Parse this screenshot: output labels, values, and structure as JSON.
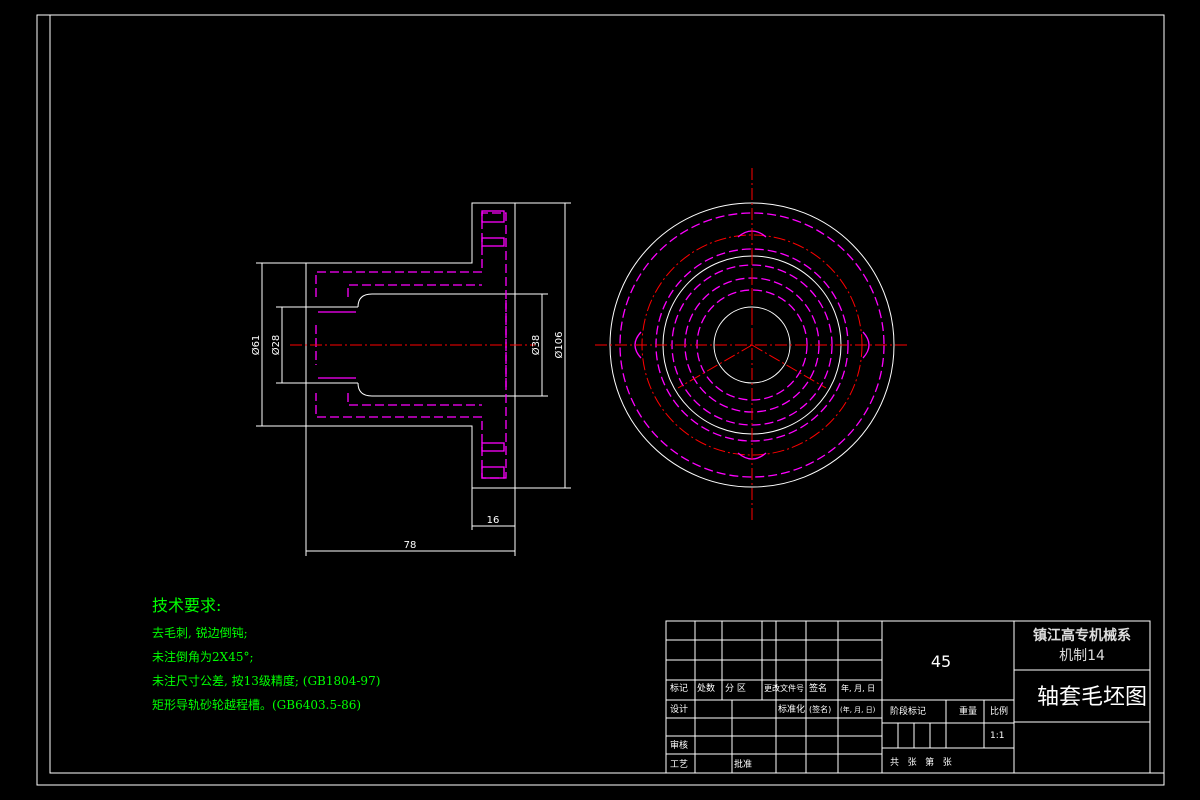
{
  "dimensions": {
    "d61": "Ø61",
    "d28": "Ø28",
    "d38": "Ø38",
    "d106": "Ø106",
    "len16": "16",
    "len78": "78"
  },
  "tech": {
    "heading": "技术要求:",
    "lines": [
      "去毛刺, 锐边倒钝;",
      "未注倒角为2X45°;",
      "未注尺寸公差, 按13级精度; (GB1804-97)",
      "矩形导轨砂轮越程槽。(GB6403.5-86)"
    ]
  },
  "title_block": {
    "material": "45",
    "school_line1": "镇江高专机械系",
    "school_line2": "机制14",
    "drawing_name": "轴套毛坯图",
    "headers": {
      "mark": "标记",
      "count": "处数",
      "zone": "分 区",
      "change_doc": "更改文件号",
      "sign": "签名",
      "date": "年, 月, 日",
      "design": "设计",
      "standardize": "标准化",
      "sign2": "(签名)",
      "date2": "(年, 月, 日)",
      "review": "审核",
      "process": "工艺",
      "approve": "批准",
      "stage_mark": "阶段标记",
      "weight": "重量",
      "scale": "比例",
      "scale_value": "1:1",
      "sheets": "共   张   第   张"
    }
  },
  "colors": {
    "border": "#ffffff",
    "hidden_lines": "#ff00ff",
    "center_lines": "#ff0000",
    "notes": "#00ff00"
  }
}
